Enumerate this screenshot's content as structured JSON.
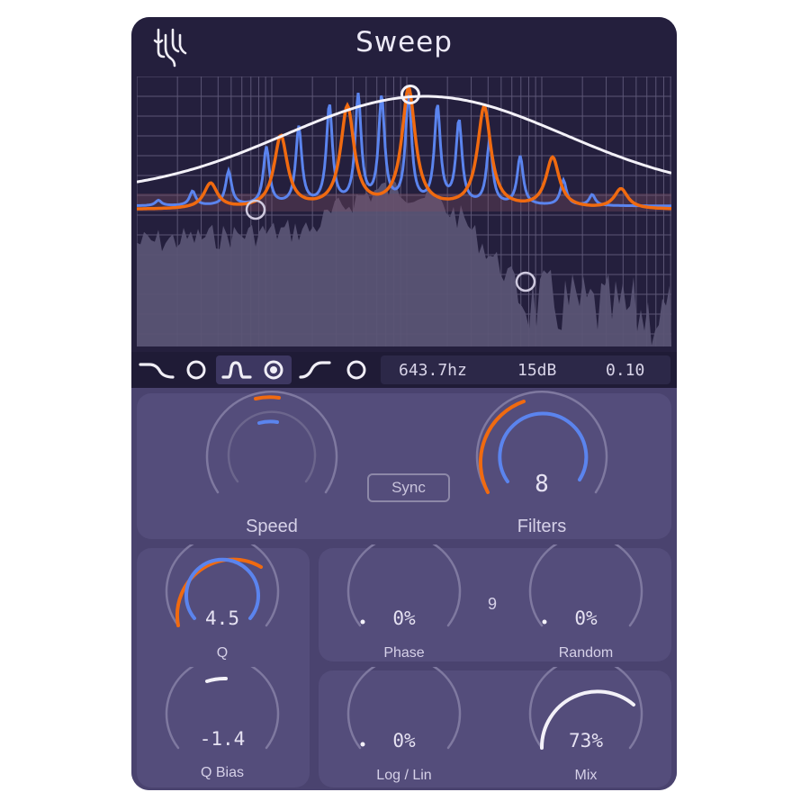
{
  "app": {
    "title": "Sweep",
    "logo_icon": "stylized-glyph-logo"
  },
  "colors": {
    "header_bg": "#241f3d",
    "panel_bg": "#544d7b",
    "body_bg": "#4a436f",
    "accent_orange": "#f06a10",
    "accent_blue": "#5b84ee",
    "curve_white": "#f3f1f8",
    "spectrum_fill": "#5a5474"
  },
  "display": {
    "handles_count": 3,
    "spectrum": "analyzer",
    "curves": [
      "orange",
      "blue",
      "white"
    ]
  },
  "filter_types": [
    {
      "name": "low-pass",
      "icon": "lowpass-curve-icon",
      "active": false
    },
    {
      "name": "band-pass",
      "icon": "bandpass-curve-icon",
      "active": true
    },
    {
      "name": "high-pass",
      "icon": "highpass-curve-icon",
      "active": false
    }
  ],
  "readout": {
    "frequency": "643.7hz",
    "gain": "15dB",
    "width": "0.10"
  },
  "controls": {
    "speed": {
      "label": "Speed",
      "value_fraction": 0.05
    },
    "sync": {
      "label": "Sync"
    },
    "filters": {
      "label": "Filters",
      "value": "8",
      "value_fraction": 0.75
    },
    "q": {
      "label": "Q",
      "value": "4.5",
      "value_fraction": 0.68
    },
    "q_bias": {
      "label": "Q Bias",
      "value": "-1.4",
      "value_fraction": 0.32
    },
    "phase": {
      "label": "Phase",
      "value": "0%"
    },
    "random": {
      "label": "Random",
      "value": "0%"
    },
    "lfo_count": "9",
    "log_lin": {
      "label": "Log / Lin",
      "value": "0%"
    },
    "mix": {
      "label": "Mix",
      "value": "73%",
      "value_fraction": 0.73
    }
  }
}
